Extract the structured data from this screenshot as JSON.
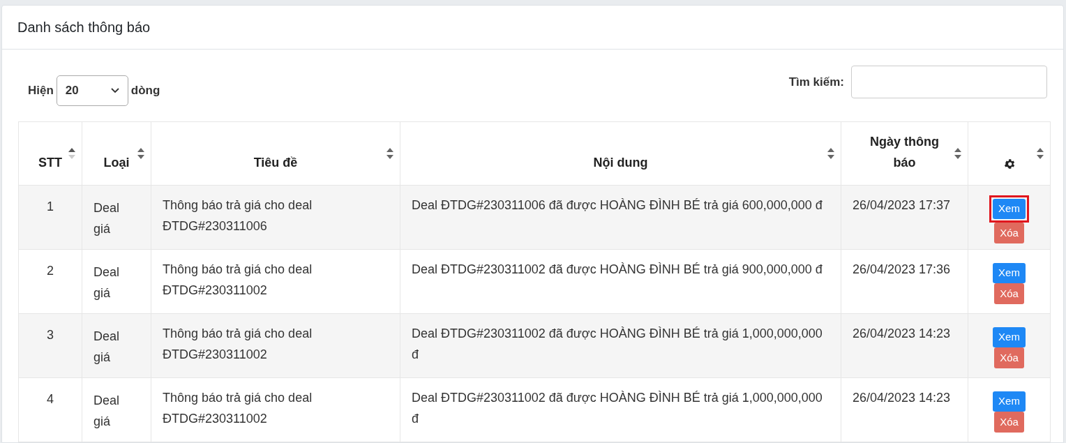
{
  "card": {
    "title": "Danh sách thông báo"
  },
  "length": {
    "label_before": "Hiện",
    "value": "20",
    "label_after": "dòng"
  },
  "search": {
    "label": "Tìm kiếm:"
  },
  "table": {
    "columns": [
      {
        "kind": "text",
        "label": "STT",
        "sorted_ascending": true
      },
      {
        "kind": "text",
        "label": "Loại",
        "sorted_ascending": false
      },
      {
        "kind": "text",
        "label": "Tiêu đề",
        "sorted_ascending": false
      },
      {
        "kind": "text",
        "label": "Nội dung",
        "sorted_ascending": false
      },
      {
        "kind": "text",
        "label": "Ngày thông báo",
        "sorted_ascending": false
      },
      {
        "kind": "icon",
        "sorted_ascending": false
      }
    ],
    "rows": [
      {
        "stt": "1",
        "type": "Deal giá",
        "title": "Thông báo trả giá cho deal ĐTDG#230311006",
        "content": "Deal ĐTDG#230311006 đã được HOÀNG ĐÌNH BÉ trả giá 600,000,000 đ",
        "date": "26/04/2023 17:37",
        "view": {
          "label": "Xem",
          "highlighted": true
        },
        "delete": "Xóa"
      },
      {
        "stt": "2",
        "type": "Deal giá",
        "title": "Thông báo trả giá cho deal ĐTDG#230311002",
        "content": "Deal ĐTDG#230311002 đã được HOÀNG ĐÌNH BÉ trả giá 900,000,000 đ",
        "date": "26/04/2023 17:36",
        "view": {
          "label": "Xem",
          "highlighted": false
        },
        "delete": "Xóa"
      },
      {
        "stt": "3",
        "type": "Deal giá",
        "title": "Thông báo trả giá cho deal ĐTDG#230311002",
        "content": "Deal ĐTDG#230311002 đã được HOÀNG ĐÌNH BÉ trả giá 1,000,000,000 đ",
        "date": "26/04/2023 14:23",
        "view": {
          "label": "Xem",
          "highlighted": false
        },
        "delete": "Xóa"
      },
      {
        "stt": "4",
        "type": "Deal giá",
        "title": "Thông báo trả giá cho deal ĐTDG#230311002",
        "content": "Deal ĐTDG#230311002 đã được HOÀNG ĐÌNH BÉ trả giá 1,000,000,000 đ",
        "date": "26/04/2023 14:23",
        "view": {
          "label": "Xem",
          "highlighted": false
        },
        "delete": "Xóa"
      }
    ]
  }
}
